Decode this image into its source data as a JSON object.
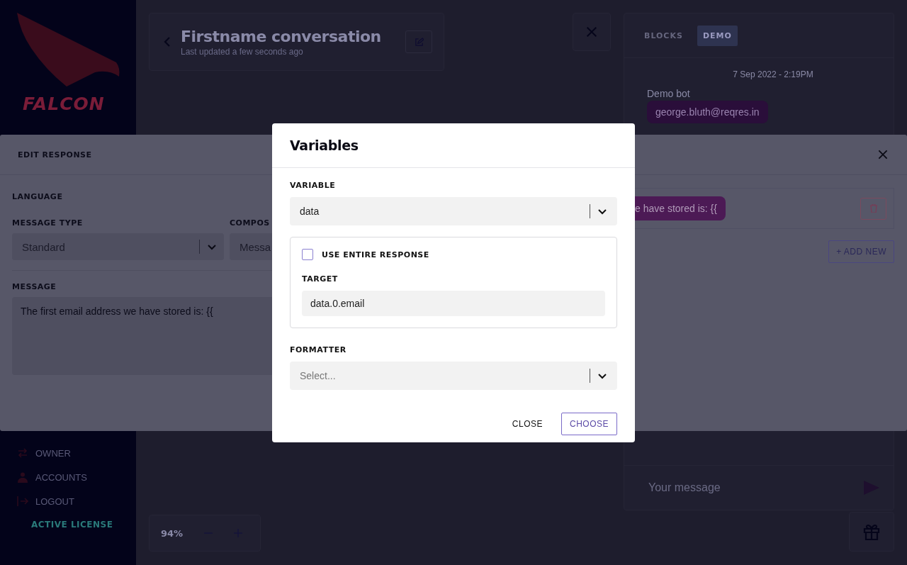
{
  "sidebar": {
    "brand": "FALCON",
    "nav": [
      {
        "label": "OWNER"
      },
      {
        "label": "ACCOUNTS"
      },
      {
        "label": "LOGOUT"
      }
    ],
    "license": "ACTIVE LICENSE"
  },
  "header": {
    "title": "Firstname conversation",
    "subtitle": "Last updated a few seconds ago"
  },
  "zoom": {
    "value": "94%"
  },
  "chat": {
    "tabs": [
      {
        "label": "BLOCKS",
        "selected": false
      },
      {
        "label": "DEMO",
        "selected": true
      }
    ],
    "timestamp": "7 Sep 2022 - 2:19PM",
    "sender": "Demo bot",
    "message": "george.bluth@reqres.in",
    "input_placeholder": "Your message"
  },
  "edit_response": {
    "title": "EDIT RESPONSE",
    "language_label": "LANGUAGE",
    "message_type_label": "MESSAGE TYPE",
    "message_type_value": "Standard",
    "composer_label": "COMPOS",
    "composer_value": "Messa",
    "message_label": "MESSAGE",
    "message": "The first email address we have stored is: {{",
    "preview": "e have stored is: {{",
    "add_new": "+ ADD NEW"
  },
  "variables_modal": {
    "title": "Variables",
    "variable_label": "VARIABLE",
    "variable_value": "data",
    "use_entire_response": {
      "label": "USE ENTIRE RESPONSE",
      "checked": false
    },
    "target_label": "TARGET",
    "target_value": "data.0.email",
    "formatter_label": "FORMATTER",
    "formatter_placeholder": "Select...",
    "buttons": [
      {
        "label": "CLOSE",
        "kind": "text"
      },
      {
        "label": "CHOOSE",
        "kind": "outlined"
      }
    ]
  }
}
